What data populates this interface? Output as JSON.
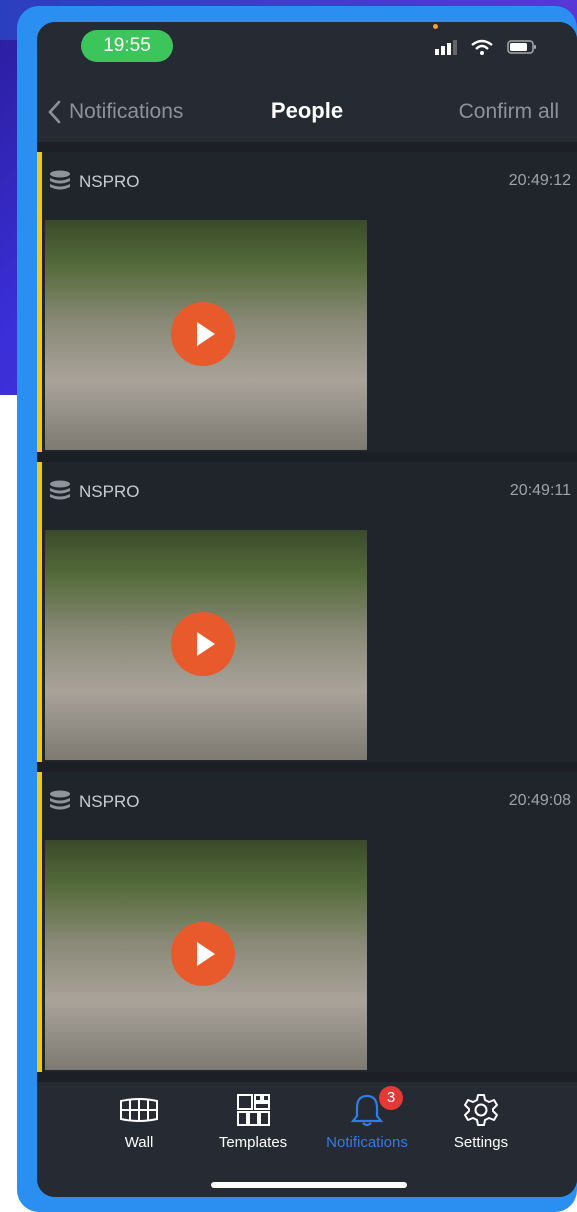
{
  "status": {
    "time": "19:55"
  },
  "nav": {
    "back_label": "Notifications",
    "title": "People",
    "confirm_label": "Confirm all"
  },
  "notifications": [
    {
      "source": "NSPRO",
      "time": "20:49:12"
    },
    {
      "source": "NSPRO",
      "time": "20:49:11"
    },
    {
      "source": "NSPRO",
      "time": "20:49:08"
    }
  ],
  "tabs": [
    {
      "label": "Wall",
      "icon": "wall-grid-icon"
    },
    {
      "label": "Templates",
      "icon": "templates-icon"
    },
    {
      "label": "Notifications",
      "icon": "bell-icon",
      "active": true,
      "badge": "3"
    },
    {
      "label": "Settings",
      "icon": "gear-icon"
    }
  ],
  "colors": {
    "accent": "#f5c518",
    "play": "#e85a2c",
    "active_tab": "#2f7de8",
    "badge": "#e53935",
    "status_pill": "#3cc55a"
  }
}
